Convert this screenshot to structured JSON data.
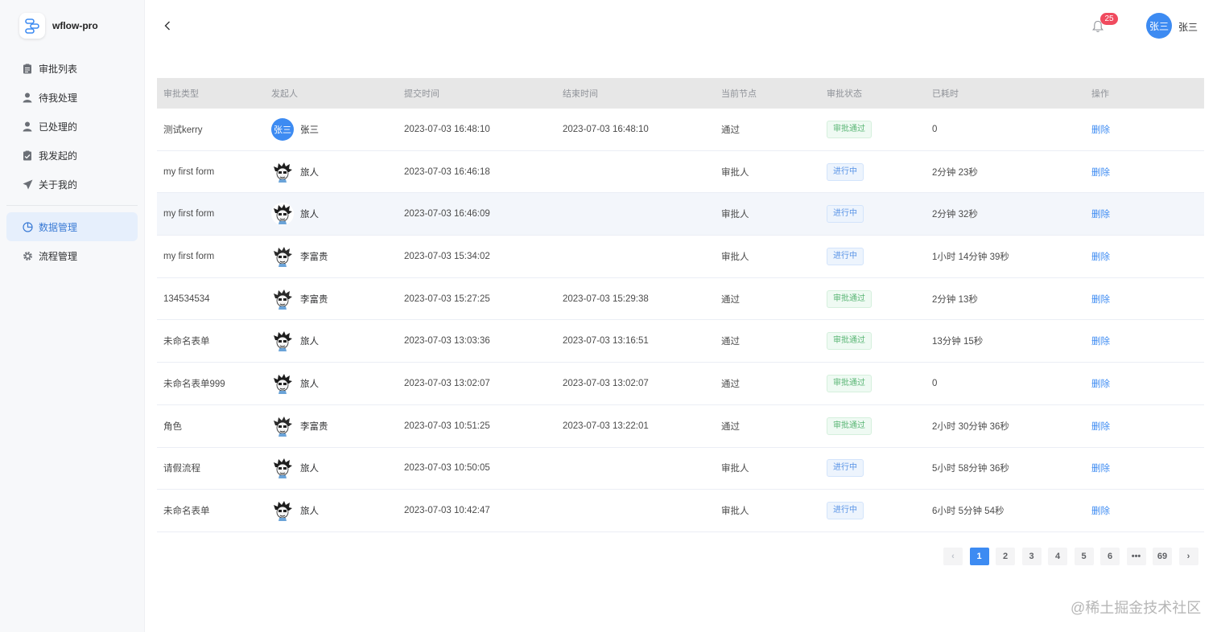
{
  "brand": {
    "name": "wflow-pro"
  },
  "sidebar": {
    "items": [
      {
        "label": "审批列表",
        "icon": "clipboard-icon"
      },
      {
        "label": "待我处理",
        "icon": "user-icon"
      },
      {
        "label": "已处理的",
        "icon": "user-check-icon"
      },
      {
        "label": "我发起的",
        "icon": "check-document-icon"
      },
      {
        "label": "关于我的",
        "icon": "send-icon"
      }
    ],
    "items2": [
      {
        "label": "数据管理",
        "icon": "pie-chart-icon",
        "active": true
      },
      {
        "label": "流程管理",
        "icon": "gear-icon"
      }
    ]
  },
  "header": {
    "notification_count": "25",
    "user_avatar_text": "张三",
    "user_name": "张三"
  },
  "table": {
    "columns": [
      "审批类型",
      "发起人",
      "提交时间",
      "结束时间",
      "当前节点",
      "审批状态",
      "已耗时",
      "操作"
    ],
    "rows": [
      {
        "type": "测试kerry",
        "user": "张三",
        "avatar": "text",
        "avatar_text": "张三",
        "submit": "2023-07-03 16:48:10",
        "end": "2023-07-03 16:48:10",
        "node": "通过",
        "status": "审批通过",
        "status_kind": "success",
        "duration": "0",
        "op": "删除"
      },
      {
        "type": "my first form",
        "user": "旅人",
        "avatar": "pic",
        "submit": "2023-07-03 16:46:18",
        "end": "",
        "node": "审批人",
        "status": "进行中",
        "status_kind": "progress",
        "duration": "2分钟 23秒",
        "op": "删除"
      },
      {
        "type": "my first form",
        "user": "旅人",
        "avatar": "pic",
        "submit": "2023-07-03 16:46:09",
        "end": "",
        "node": "审批人",
        "status": "进行中",
        "status_kind": "progress",
        "duration": "2分钟 32秒",
        "op": "删除",
        "highlight": true
      },
      {
        "type": "my first form",
        "user": "李富贵",
        "avatar": "pic2",
        "submit": "2023-07-03 15:34:02",
        "end": "",
        "node": "审批人",
        "status": "进行中",
        "status_kind": "progress",
        "duration": "1小时 14分钟 39秒",
        "op": "删除"
      },
      {
        "type": "134534534",
        "user": "李富贵",
        "avatar": "pic2",
        "submit": "2023-07-03 15:27:25",
        "end": "2023-07-03 15:29:38",
        "node": "通过",
        "status": "审批通过",
        "status_kind": "success",
        "duration": "2分钟 13秒",
        "op": "删除"
      },
      {
        "type": "未命名表单",
        "user": "旅人",
        "avatar": "pic",
        "submit": "2023-07-03 13:03:36",
        "end": "2023-07-03 13:16:51",
        "node": "通过",
        "status": "审批通过",
        "status_kind": "success",
        "duration": "13分钟 15秒",
        "op": "删除"
      },
      {
        "type": "未命名表单999",
        "user": "旅人",
        "avatar": "pic",
        "submit": "2023-07-03 13:02:07",
        "end": "2023-07-03 13:02:07",
        "node": "通过",
        "status": "审批通过",
        "status_kind": "success",
        "duration": "0",
        "op": "删除"
      },
      {
        "type": "角色",
        "user": "李富贵",
        "avatar": "pic2",
        "submit": "2023-07-03 10:51:25",
        "end": "2023-07-03 13:22:01",
        "node": "通过",
        "status": "审批通过",
        "status_kind": "success",
        "duration": "2小时 30分钟 36秒",
        "op": "删除"
      },
      {
        "type": "请假流程",
        "user": "旅人",
        "avatar": "pic",
        "submit": "2023-07-03 10:50:05",
        "end": "",
        "node": "审批人",
        "status": "进行中",
        "status_kind": "progress",
        "duration": "5小时 58分钟 36秒",
        "op": "删除"
      },
      {
        "type": "未命名表单",
        "user": "旅人",
        "avatar": "pic",
        "submit": "2023-07-03 10:42:47",
        "end": "",
        "node": "审批人",
        "status": "进行中",
        "status_kind": "progress",
        "duration": "6小时 5分钟 54秒",
        "op": "删除"
      }
    ]
  },
  "pagination": {
    "prev": "‹",
    "pages": [
      "1",
      "2",
      "3",
      "4",
      "5",
      "6",
      "•••",
      "69"
    ],
    "current": "1",
    "next": "›"
  },
  "watermark": "@稀土掘金技术社区",
  "colors": {
    "accent": "#3d8bf2",
    "success": "#5ab675",
    "badge": "#f04b5f"
  }
}
